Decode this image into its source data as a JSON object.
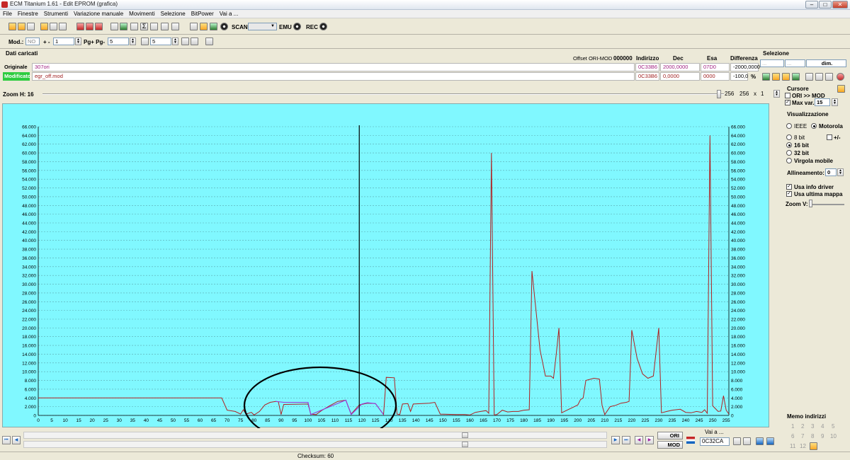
{
  "window": {
    "title": "ECM Titanium 1.61 - Edit EPROM (grafica)"
  },
  "menu": [
    "File",
    "Finestre",
    "Strumenti",
    "Variazione manuale",
    "Movimenti",
    "Selezione",
    "BitPower",
    "Vai a ..."
  ],
  "toolbar1": {
    "scan_label": "SCAN",
    "emu_label": "EMU",
    "rec_label": "REC"
  },
  "toolbar2": {
    "mod_label": "Mod.:",
    "mod_value": "NO",
    "plusminus_label": "+ -",
    "plusminus_value": "1",
    "pg_label": "Pg+ Pg-",
    "pg_value": "5",
    "step_value": "5"
  },
  "loaded": {
    "title": "Dati caricati",
    "offset_label": "Offset ORI-MOD",
    "offset_value": "000000",
    "col_indirizzo": "Indirizzo",
    "col_dec": "Dec",
    "col_esa": "Esa",
    "col_diff": "Differenza",
    "original": {
      "label": "Originale",
      "file": "307ori",
      "address": "0C33B6",
      "dec": "2000,0000",
      "hex": "07D0",
      "diff": "-2000,0000"
    },
    "modified": {
      "label": "Modificato",
      "file": "egr_off.mod",
      "address": "0C33B6",
      "dec": "0,0000",
      "hex": "0000",
      "diff": "-100,0",
      "diff_unit": "%"
    }
  },
  "selection": {
    "title": "Selezione",
    "field1": "...",
    "field2": "...",
    "dim_label": "dim."
  },
  "zoom": {
    "label": "Zoom H: 16",
    "value1": "256",
    "value2": "256",
    "x_label": "x",
    "mult": "1"
  },
  "right_panel": {
    "cursor_title": "Cursore",
    "ori_mod": "ORI >> MOD",
    "max_var_label": "Max var.",
    "max_var_value": "15",
    "vis_title": "Visualizzazione",
    "ieee": "IEEE",
    "motorola": "Motorola",
    "bit8": "8 bit",
    "plusminus": "+/-",
    "bit16": "16 bit",
    "bit32": "32 bit",
    "float": "Virgola mobile",
    "align_label": "Allineamento:",
    "align_value": "0",
    "use_driver": "Usa info driver",
    "use_last": "Usa ultima mappa",
    "zoom_v": "Zoom V:"
  },
  "memo": {
    "title": "Memo indirizzi",
    "nums": [
      "1",
      "2",
      "3",
      "4",
      "5",
      "6",
      "7",
      "8",
      "9",
      "10",
      "11",
      "12"
    ]
  },
  "bottom": {
    "ori_label": "ORI",
    "mod_label": "MOD",
    "goto_label": "Vai a ...",
    "goto_value": "0C32CA"
  },
  "status": {
    "checksum": "Checksum: 60"
  },
  "chart_data": {
    "type": "line",
    "ylim": [
      0,
      66000
    ],
    "xlim": [
      0,
      256
    ],
    "yticks": [
      "0",
      "2.000",
      "4.000",
      "6.000",
      "8.000",
      "10.000",
      "12.000",
      "14.000",
      "16.000",
      "18.000",
      "20.000",
      "22.000",
      "24.000",
      "26.000",
      "28.000",
      "30.000",
      "32.000",
      "34.000",
      "36.000",
      "38.000",
      "40.000",
      "42.000",
      "44.000",
      "46.000",
      "48.000",
      "50.000",
      "52.000",
      "54.000",
      "56.000",
      "58.000",
      "60.000",
      "62.000",
      "64.000",
      "66.000"
    ],
    "xticks": [
      "0",
      "5",
      "10",
      "15",
      "20",
      "25",
      "30",
      "35",
      "40",
      "45",
      "50",
      "55",
      "60",
      "65",
      "70",
      "75",
      "80",
      "85",
      "90",
      "95",
      "100",
      "105",
      "110",
      "115",
      "120",
      "125",
      "130",
      "135",
      "140",
      "145",
      "150",
      "155",
      "160",
      "165",
      "170",
      "175",
      "180",
      "185",
      "190",
      "195",
      "200",
      "205",
      "210",
      "215",
      "220",
      "225",
      "230",
      "235",
      "240",
      "245",
      "250",
      "255"
    ],
    "cursor_x": 119,
    "series": [
      {
        "color": "#b02020",
        "points": [
          [
            0,
            4000
          ],
          [
            68,
            4000
          ],
          [
            70,
            1200
          ],
          [
            73,
            900
          ],
          [
            75,
            300
          ],
          [
            76,
            1300
          ],
          [
            77,
            300
          ],
          [
            79,
            700
          ],
          [
            80,
            100
          ],
          [
            82,
            900
          ],
          [
            84,
            2400
          ],
          [
            86,
            3000
          ],
          [
            88,
            3200
          ],
          [
            89,
            3100
          ],
          [
            90,
            200
          ],
          [
            91,
            2500
          ],
          [
            100,
            2600
          ],
          [
            101,
            300
          ],
          [
            103,
            200
          ],
          [
            105,
            1100
          ],
          [
            108,
            2200
          ],
          [
            111,
            3200
          ],
          [
            114,
            3500
          ],
          [
            116,
            300
          ],
          [
            119,
            2400
          ],
          [
            122,
            2800
          ],
          [
            125,
            2700
          ],
          [
            128,
            200
          ],
          [
            129,
            8700
          ],
          [
            132,
            8600
          ],
          [
            133,
            300
          ],
          [
            134,
            200
          ],
          [
            135,
            2600
          ],
          [
            137,
            2700
          ],
          [
            138,
            900
          ],
          [
            139,
            2600
          ],
          [
            145,
            2800
          ],
          [
            147,
            3000
          ],
          [
            149,
            300
          ],
          [
            155,
            200
          ],
          [
            158,
            200
          ],
          [
            160,
            100
          ],
          [
            162,
            700
          ],
          [
            164,
            900
          ],
          [
            166,
            1100
          ],
          [
            167,
            500
          ],
          [
            168,
            60000
          ],
          [
            169,
            100
          ],
          [
            170,
            200
          ],
          [
            172,
            1200
          ],
          [
            174,
            800
          ],
          [
            176,
            900
          ],
          [
            178,
            900
          ],
          [
            180,
            1200
          ],
          [
            182,
            1300
          ],
          [
            183,
            33000
          ],
          [
            186,
            15000
          ],
          [
            188,
            9000
          ],
          [
            190,
            9000
          ],
          [
            191,
            8500
          ],
          [
            192,
            14000
          ],
          [
            193,
            20000
          ],
          [
            194,
            600
          ],
          [
            196,
            1200
          ],
          [
            198,
            1800
          ],
          [
            200,
            2400
          ],
          [
            201,
            3600
          ],
          [
            202,
            4000
          ],
          [
            203,
            8000
          ],
          [
            206,
            8500
          ],
          [
            208,
            8300
          ],
          [
            209,
            2300
          ],
          [
            210,
            200
          ],
          [
            212,
            2000
          ],
          [
            214,
            2300
          ],
          [
            216,
            2800
          ],
          [
            218,
            3000
          ],
          [
            219,
            3200
          ],
          [
            220,
            19500
          ],
          [
            222,
            13000
          ],
          [
            224,
            9500
          ],
          [
            226,
            8500
          ],
          [
            228,
            9000
          ],
          [
            230,
            20000
          ],
          [
            231,
            600
          ],
          [
            233,
            900
          ],
          [
            235,
            1200
          ],
          [
            238,
            1400
          ],
          [
            240,
            700
          ],
          [
            242,
            600
          ],
          [
            244,
            900
          ],
          [
            246,
            700
          ],
          [
            247,
            1300
          ],
          [
            248,
            500
          ],
          [
            249,
            64000
          ],
          [
            250,
            2200
          ],
          [
            252,
            900
          ],
          [
            253,
            1000
          ],
          [
            254,
            4500
          ],
          [
            255,
            1200
          ],
          [
            256,
            300
          ]
        ]
      },
      {
        "color": "#9a38d8",
        "points": [
          [
            88,
            3200
          ],
          [
            91,
            3000
          ],
          [
            100,
            3000
          ],
          [
            101,
            200
          ],
          [
            114,
            3500
          ],
          [
            116,
            200
          ],
          [
            120,
            2600
          ],
          [
            122,
            2900
          ],
          [
            125,
            2700
          ],
          [
            128,
            200
          ]
        ]
      }
    ]
  }
}
